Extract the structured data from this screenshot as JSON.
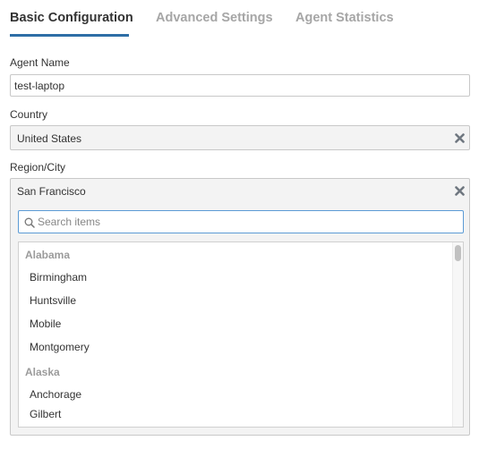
{
  "tabs": [
    {
      "label": "Basic Configuration",
      "active": true
    },
    {
      "label": "Advanced Settings",
      "active": false
    },
    {
      "label": "Agent Statistics",
      "active": false
    }
  ],
  "form": {
    "agent_name": {
      "label": "Agent Name",
      "value": "test-laptop"
    },
    "country": {
      "label": "Country",
      "value": "United States"
    },
    "region_city": {
      "label": "Region/City",
      "value": "San Francisco"
    }
  },
  "dropdown": {
    "search_placeholder": "Search items",
    "groups": [
      {
        "label": "Alabama",
        "items": [
          "Birmingham",
          "Huntsville",
          "Mobile",
          "Montgomery"
        ]
      },
      {
        "label": "Alaska",
        "items": [
          "Anchorage",
          "Gilbert"
        ]
      }
    ]
  },
  "colors": {
    "accent": "#2e6ea6",
    "search_focus": "#5b9bd5",
    "inactive_tab": "#a6a6a6"
  },
  "icons": {
    "clear": "close-icon",
    "search": "search-icon"
  }
}
